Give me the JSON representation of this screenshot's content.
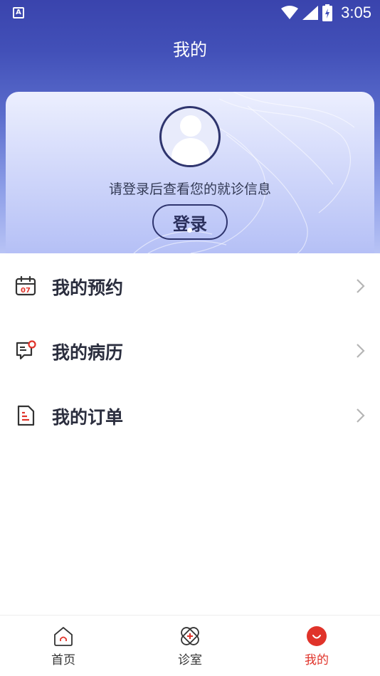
{
  "status_bar": {
    "left_icon_label": "A",
    "time": "3:05"
  },
  "header": {
    "title": "我的"
  },
  "profile": {
    "login_hint": "请登录后查看您的就诊信息",
    "login_button": "登录"
  },
  "menu": {
    "items": [
      {
        "label": "我的预约",
        "icon": "calendar-icon"
      },
      {
        "label": "我的病历",
        "icon": "medical-record-icon"
      },
      {
        "label": "我的订单",
        "icon": "order-document-icon"
      }
    ]
  },
  "bottom_nav": {
    "items": [
      {
        "label": "首页",
        "icon": "home-icon",
        "active": false
      },
      {
        "label": "诊室",
        "icon": "clinic-icon",
        "active": false
      },
      {
        "label": "我的",
        "icon": "profile-smile-icon",
        "active": true
      }
    ]
  },
  "colors": {
    "header_primary": "#3a44ad",
    "accent_red": "#e0332a",
    "text_dark": "#2b2e3e"
  }
}
